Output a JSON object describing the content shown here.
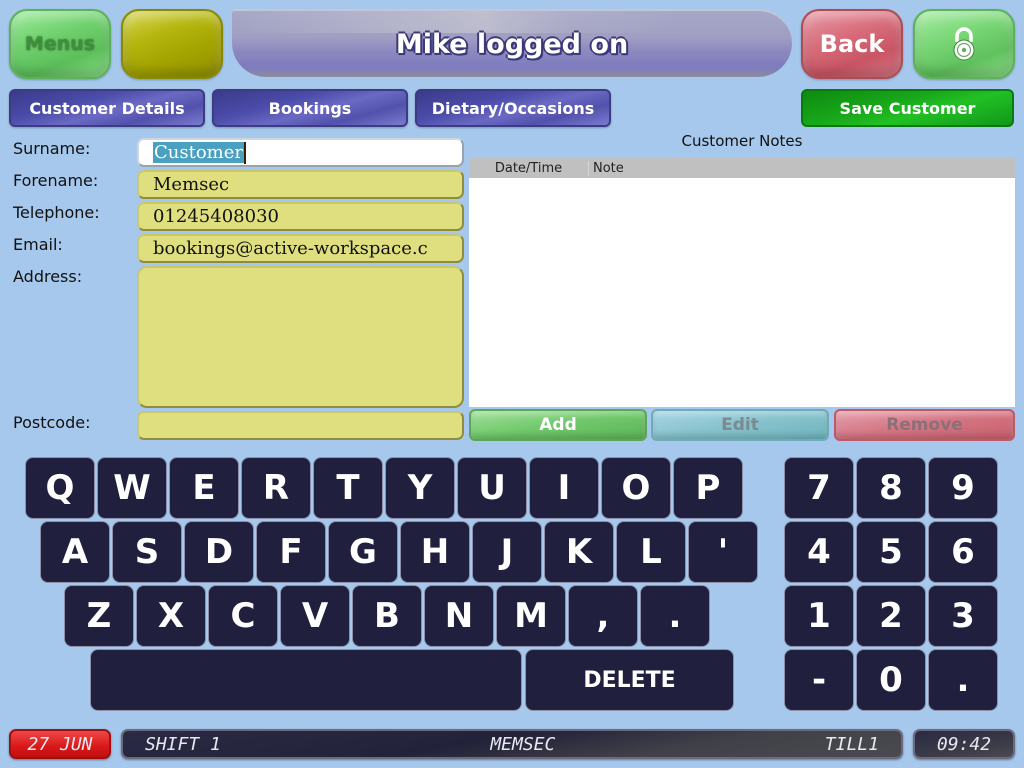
{
  "header": {
    "menus_label": "Menus",
    "title": "Mike logged on",
    "back_label": "Back",
    "lock_icon": "padlock-icon"
  },
  "tabs": [
    {
      "label": "Customer Details"
    },
    {
      "label": "Bookings"
    },
    {
      "label": "Dietary/Occasions"
    }
  ],
  "save_label": "Save Customer",
  "form": {
    "surname": {
      "label": "Surname:",
      "value": "Customer"
    },
    "forename": {
      "label": "Forename:",
      "value": "Memsec"
    },
    "telephone": {
      "label": "Telephone:",
      "value": "01245408030"
    },
    "email": {
      "label": "Email:",
      "value": "bookings@active-workspace.c"
    },
    "address": {
      "label": "Address:",
      "value": ""
    },
    "postcode": {
      "label": "Postcode:",
      "value": ""
    }
  },
  "notes": {
    "title": "Customer Notes",
    "columns": [
      "Date/Time",
      "Note"
    ],
    "rows": [],
    "add_label": "Add",
    "edit_label": "Edit",
    "remove_label": "Remove"
  },
  "keyboard": {
    "row1": [
      "Q",
      "W",
      "E",
      "R",
      "T",
      "Y",
      "U",
      "I",
      "O",
      "P"
    ],
    "row2": [
      "A",
      "S",
      "D",
      "F",
      "G",
      "H",
      "J",
      "K",
      "L",
      "'"
    ],
    "row3": [
      "Z",
      "X",
      "C",
      "V",
      "B",
      "N",
      "M",
      ",",
      "."
    ],
    "space_label": "",
    "delete_label": "DELETE",
    "numpad": [
      "7",
      "8",
      "9",
      "4",
      "5",
      "6",
      "1",
      "2",
      "3",
      "-",
      "0",
      "."
    ]
  },
  "status": {
    "date": "27 JUN",
    "shift": "SHIFT 1",
    "user": "MEMSEC",
    "till": "TILL1",
    "time": "09:42"
  }
}
